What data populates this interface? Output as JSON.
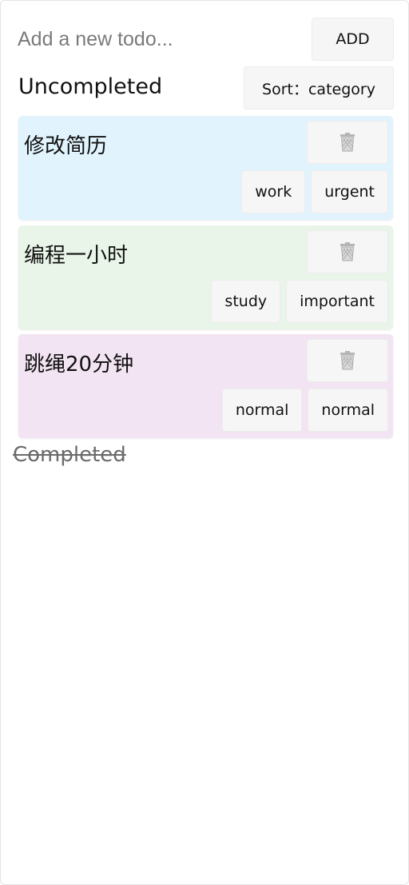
{
  "header": {
    "input_placeholder": "Add a new todo...",
    "input_value": "",
    "add_label": "ADD"
  },
  "uncompleted": {
    "title": "Uncompleted",
    "sort_label": "Sort：category"
  },
  "todos": [
    {
      "title": "修改简历",
      "tags": [
        "work",
        "urgent"
      ],
      "color": "#e1f3fc",
      "delete_icon": "trash-icon"
    },
    {
      "title": "编程一小时",
      "tags": [
        "study",
        "important"
      ],
      "color": "#e9f5e8",
      "delete_icon": "trash-icon"
    },
    {
      "title": "跳绳20分钟",
      "tags": [
        "normal",
        "normal"
      ],
      "color": "#f3e4f3",
      "delete_icon": "trash-icon"
    }
  ],
  "completed": {
    "title": "Completed"
  }
}
